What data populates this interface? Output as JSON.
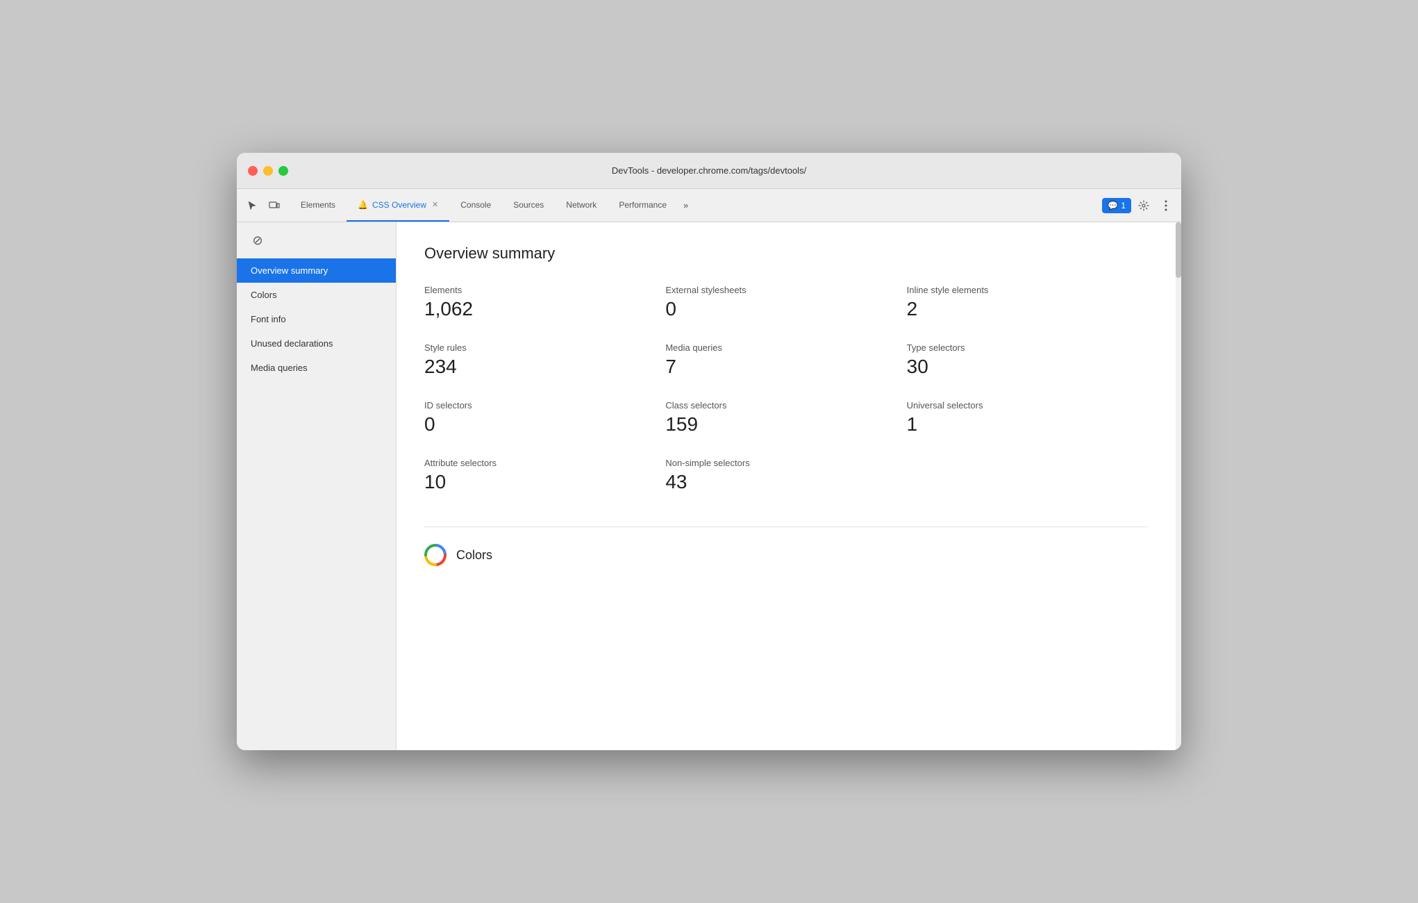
{
  "browser": {
    "title": "DevTools - developer.chrome.com/tags/devtools/"
  },
  "tabs": [
    {
      "id": "elements",
      "label": "Elements",
      "active": false,
      "closeable": false
    },
    {
      "id": "css-overview",
      "label": "CSS Overview",
      "active": true,
      "closeable": true,
      "icon": "🔔"
    },
    {
      "id": "console",
      "label": "Console",
      "active": false,
      "closeable": false
    },
    {
      "id": "sources",
      "label": "Sources",
      "active": false,
      "closeable": false
    },
    {
      "id": "network",
      "label": "Network",
      "active": false,
      "closeable": false
    },
    {
      "id": "performance",
      "label": "Performance",
      "active": false,
      "closeable": false
    }
  ],
  "tabs_more": "»",
  "badge": {
    "icon": "💬",
    "count": "1"
  },
  "sidebar": {
    "items": [
      {
        "id": "overview-summary",
        "label": "Overview summary",
        "active": true
      },
      {
        "id": "colors",
        "label": "Colors",
        "active": false
      },
      {
        "id": "font-info",
        "label": "Font info",
        "active": false
      },
      {
        "id": "unused-declarations",
        "label": "Unused declarations",
        "active": false
      },
      {
        "id": "media-queries",
        "label": "Media queries",
        "active": false
      }
    ]
  },
  "main": {
    "section_title": "Overview summary",
    "stats": [
      {
        "id": "elements",
        "label": "Elements",
        "value": "1,062"
      },
      {
        "id": "external-stylesheets",
        "label": "External stylesheets",
        "value": "0"
      },
      {
        "id": "inline-style-elements",
        "label": "Inline style elements",
        "value": "2"
      },
      {
        "id": "style-rules",
        "label": "Style rules",
        "value": "234"
      },
      {
        "id": "media-queries",
        "label": "Media queries",
        "value": "7"
      },
      {
        "id": "type-selectors",
        "label": "Type selectors",
        "value": "30"
      },
      {
        "id": "id-selectors",
        "label": "ID selectors",
        "value": "0"
      },
      {
        "id": "class-selectors",
        "label": "Class selectors",
        "value": "159"
      },
      {
        "id": "universal-selectors",
        "label": "Universal selectors",
        "value": "1"
      },
      {
        "id": "attribute-selectors",
        "label": "Attribute selectors",
        "value": "10"
      },
      {
        "id": "non-simple-selectors",
        "label": "Non-simple selectors",
        "value": "43"
      }
    ],
    "colors_section": {
      "label": "Colors"
    }
  }
}
